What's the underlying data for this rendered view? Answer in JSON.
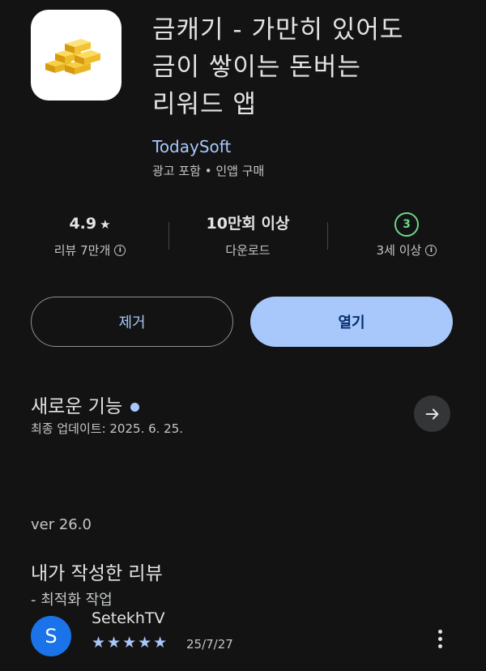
{
  "app": {
    "title_lines": [
      "금캐기 - 가만히 있어도",
      "금이 쌓이는 돈버는",
      "리워드 앱"
    ],
    "developer": "TodaySoft",
    "meta": "광고 포함 • 인앱 구매",
    "icon": "gold-bars-icon"
  },
  "stats": {
    "rating": {
      "value": "4.9",
      "label": "리뷰 7만개"
    },
    "downloads": {
      "value": "10만회 이상",
      "label": "다운로드"
    },
    "age": {
      "value": "3",
      "label": "3세 이상"
    }
  },
  "buttons": {
    "uninstall": "제거",
    "open": "열기"
  },
  "whats_new": {
    "title": "새로운 기능",
    "updated": "최종 업데이트: 2025. 6. 25.",
    "version": "ver 26.0",
    "note": "- 최적화 작업"
  },
  "my_review": {
    "title": "내가 작성한 리뷰",
    "avatar_letter": "S",
    "reviewer": "SetekhTV",
    "stars": "★★★★★",
    "date": "25/7/27"
  },
  "colors": {
    "background": "#131314",
    "accent": "#a8c7fa",
    "age_green": "#6dd58c",
    "avatar": "#1a73e8"
  }
}
